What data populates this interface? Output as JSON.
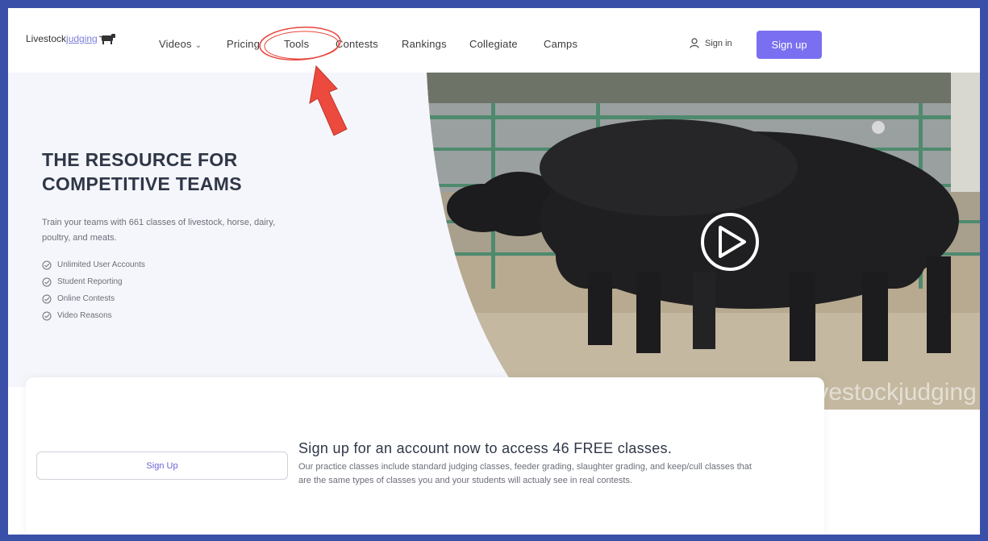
{
  "nav": {
    "logo_part1": "Livestock",
    "logo_part2": "judging",
    "items": [
      {
        "label": "Videos",
        "has_dropdown": true
      },
      {
        "label": "Pricing"
      },
      {
        "label": "Tools"
      },
      {
        "label": "Contests"
      },
      {
        "label": "Rankings"
      },
      {
        "label": "Collegiate"
      },
      {
        "label": "Camps"
      }
    ],
    "signin_label": "Sign in",
    "signup_label": "Sign up"
  },
  "hero": {
    "title": "THE RESOURCE FOR COMPETITIVE TEAMS",
    "subtitle": "Train your teams with 661 classes of livestock, horse, dairy, poultry, and meats.",
    "features": [
      "Unlimited User Accounts",
      "Student Reporting",
      "Online Contests",
      "Video Reasons"
    ],
    "watermark": "livestockjudging"
  },
  "cta": {
    "button_label": "Sign Up",
    "title": "Sign up for an account now to access 46 FREE classes.",
    "description": "Our practice classes include standard judging classes, feeder grading, slaughter grading, and keep/cull classes that are the same types of classes you and your students will actualy see in real contests."
  },
  "colors": {
    "accent": "#7a6ff0",
    "frame": "#3a4fa8",
    "annotation": "#e8453c"
  },
  "icons": [
    "cow-icon",
    "chevron-down-icon",
    "user-icon",
    "check-circle-icon",
    "play-icon",
    "arrow-annotation-icon"
  ]
}
